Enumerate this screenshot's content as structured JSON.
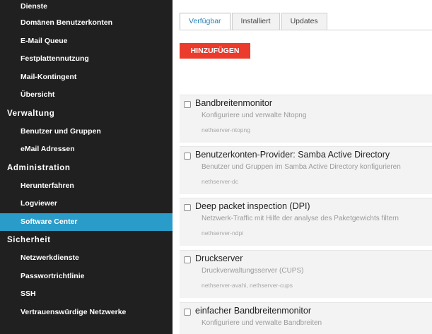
{
  "sidebar": {
    "blocks": [
      {
        "type": "item",
        "label": "Dienste"
      },
      {
        "type": "item",
        "label": "Domänen Benutzerkonten"
      },
      {
        "type": "item",
        "label": "E-Mail Queue"
      },
      {
        "type": "item",
        "label": "Festplattennutzung"
      },
      {
        "type": "item",
        "label": "Mail-Kontingent"
      },
      {
        "type": "item",
        "label": "Übersicht"
      },
      {
        "type": "section",
        "label": "Verwaltung"
      },
      {
        "type": "item",
        "label": "Benutzer und Gruppen"
      },
      {
        "type": "item",
        "label": "eMail Adressen"
      },
      {
        "type": "section",
        "label": "Administration"
      },
      {
        "type": "item",
        "label": "Herunterfahren"
      },
      {
        "type": "item",
        "label": "Logviewer"
      },
      {
        "type": "item",
        "label": "Software Center",
        "active": true
      },
      {
        "type": "section",
        "label": "Sicherheit"
      },
      {
        "type": "item",
        "label": "Netzwerkdienste"
      },
      {
        "type": "item",
        "label": "Passwortrichtlinie"
      },
      {
        "type": "item",
        "label": "SSH"
      },
      {
        "type": "item",
        "label": "Vertrauenswürdige Netzwerke"
      }
    ]
  },
  "tabs": [
    {
      "label": "Verfügbar",
      "active": true
    },
    {
      "label": "Installiert"
    },
    {
      "label": "Updates"
    }
  ],
  "add_button": "HINZUFÜGEN",
  "packages": [
    {
      "title": "Bandbreitenmonitor",
      "description": "Konfiguriere und verwalte Ntopng",
      "package": "nethserver-ntopng"
    },
    {
      "title": "Benutzerkonten-Provider: Samba Active Directory",
      "description": "Benutzer und Gruppen im Samba Active Directory konfigurieren",
      "package": "nethserver-dc"
    },
    {
      "title": "Deep packet inspection (DPI)",
      "description": "Netzwerk-Traffic mit Hilfe der analyse des Paketgewichts filtern",
      "package": "nethserver-ndpi"
    },
    {
      "title": "Druckserver",
      "description": "Druckverwaltungsserver (CUPS)",
      "package": "nethserver-avahi, nethserver-cups"
    },
    {
      "title": "einfacher Bandbreitenmonitor",
      "description": "Konfiguriere und verwalte Bandbreiten",
      "package": ""
    }
  ],
  "colors": {
    "sidebar_bg": "#202020",
    "active_item": "#2a9cc9",
    "add_button": "#ea3b2c",
    "card_bg": "#f3f3f3"
  }
}
